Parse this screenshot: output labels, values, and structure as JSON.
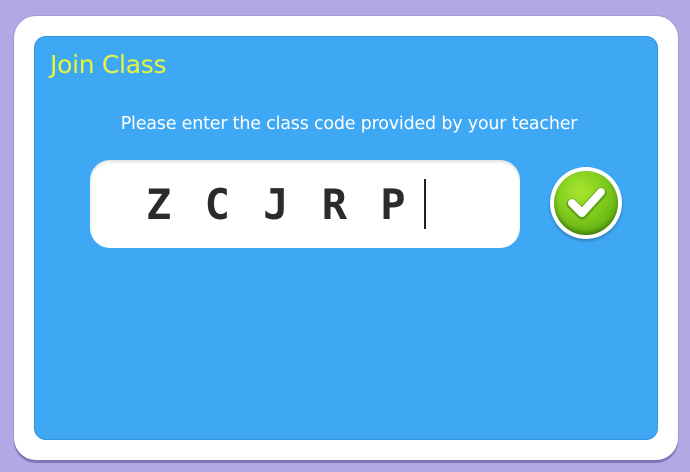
{
  "dialog": {
    "title": "Join Class",
    "instruction": "Please enter the class code provided by your teacher"
  },
  "code_input": {
    "value": "Z C J R P"
  },
  "submit_button": {
    "icon": "checkmark-icon"
  },
  "colors": {
    "background": "#b1a9e3",
    "panel": "#3fa8f5",
    "title": "#e8f53c",
    "button_green": "#7fcb1d"
  }
}
